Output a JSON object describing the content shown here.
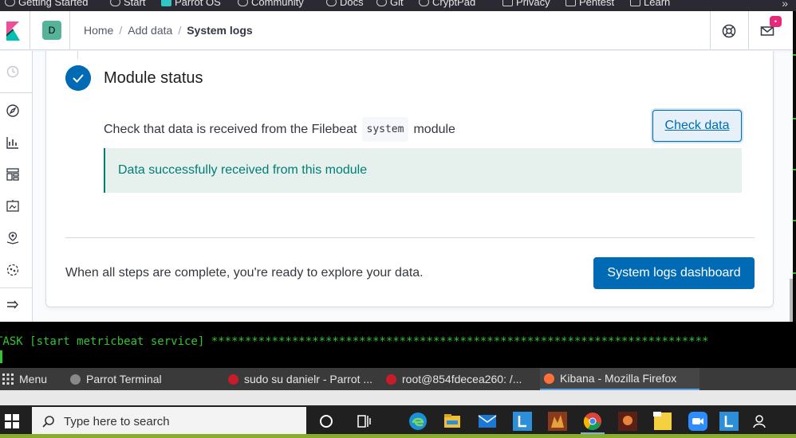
{
  "bookmarks": [
    {
      "label": "Getting Started",
      "icon": "globe-icon"
    },
    {
      "label": "Start",
      "icon": "globe-icon"
    },
    {
      "label": "Parrot OS",
      "icon": "parrot-icon"
    },
    {
      "label": "Community",
      "icon": "globe-icon"
    },
    {
      "label": "Docs",
      "icon": "globe-icon"
    },
    {
      "label": "Git",
      "icon": "globe-icon"
    },
    {
      "label": "CryptPad",
      "icon": "globe-icon"
    },
    {
      "label": "Privacy",
      "icon": "folder-icon"
    },
    {
      "label": "Pentest",
      "icon": "folder-icon"
    },
    {
      "label": "Learn",
      "icon": "folder-icon"
    }
  ],
  "header": {
    "space_initial": "D",
    "breadcrumbs": [
      "Home",
      "Add data",
      "System logs"
    ],
    "notification_badge": "•"
  },
  "step": {
    "title": "Module status",
    "description_before": "Check that data is received from the Filebeat",
    "module_code": "system",
    "description_after": "module",
    "check_button": "Check data",
    "callout": "Data successfully received from this module"
  },
  "footer": {
    "text": "When all steps are complete, you're ready to explore your data.",
    "dashboard_button": "System logs dashboard"
  },
  "terminal": {
    "line": "TASK [start metricbeat service] **************************************************************************"
  },
  "panelbar": {
    "menu": "Menu",
    "tasks": [
      "Parrot Terminal",
      "sudo su danielr - Parrot ...",
      "root@854fdecea260: /...",
      "Kibana - Mozilla Firefox"
    ]
  },
  "taskbar": {
    "search_placeholder": "Type here to search"
  },
  "colors": {
    "primary": "#006bb4",
    "success": "#017d73",
    "success_bg": "#e6f1ee",
    "terminal_green": "#31c531"
  }
}
